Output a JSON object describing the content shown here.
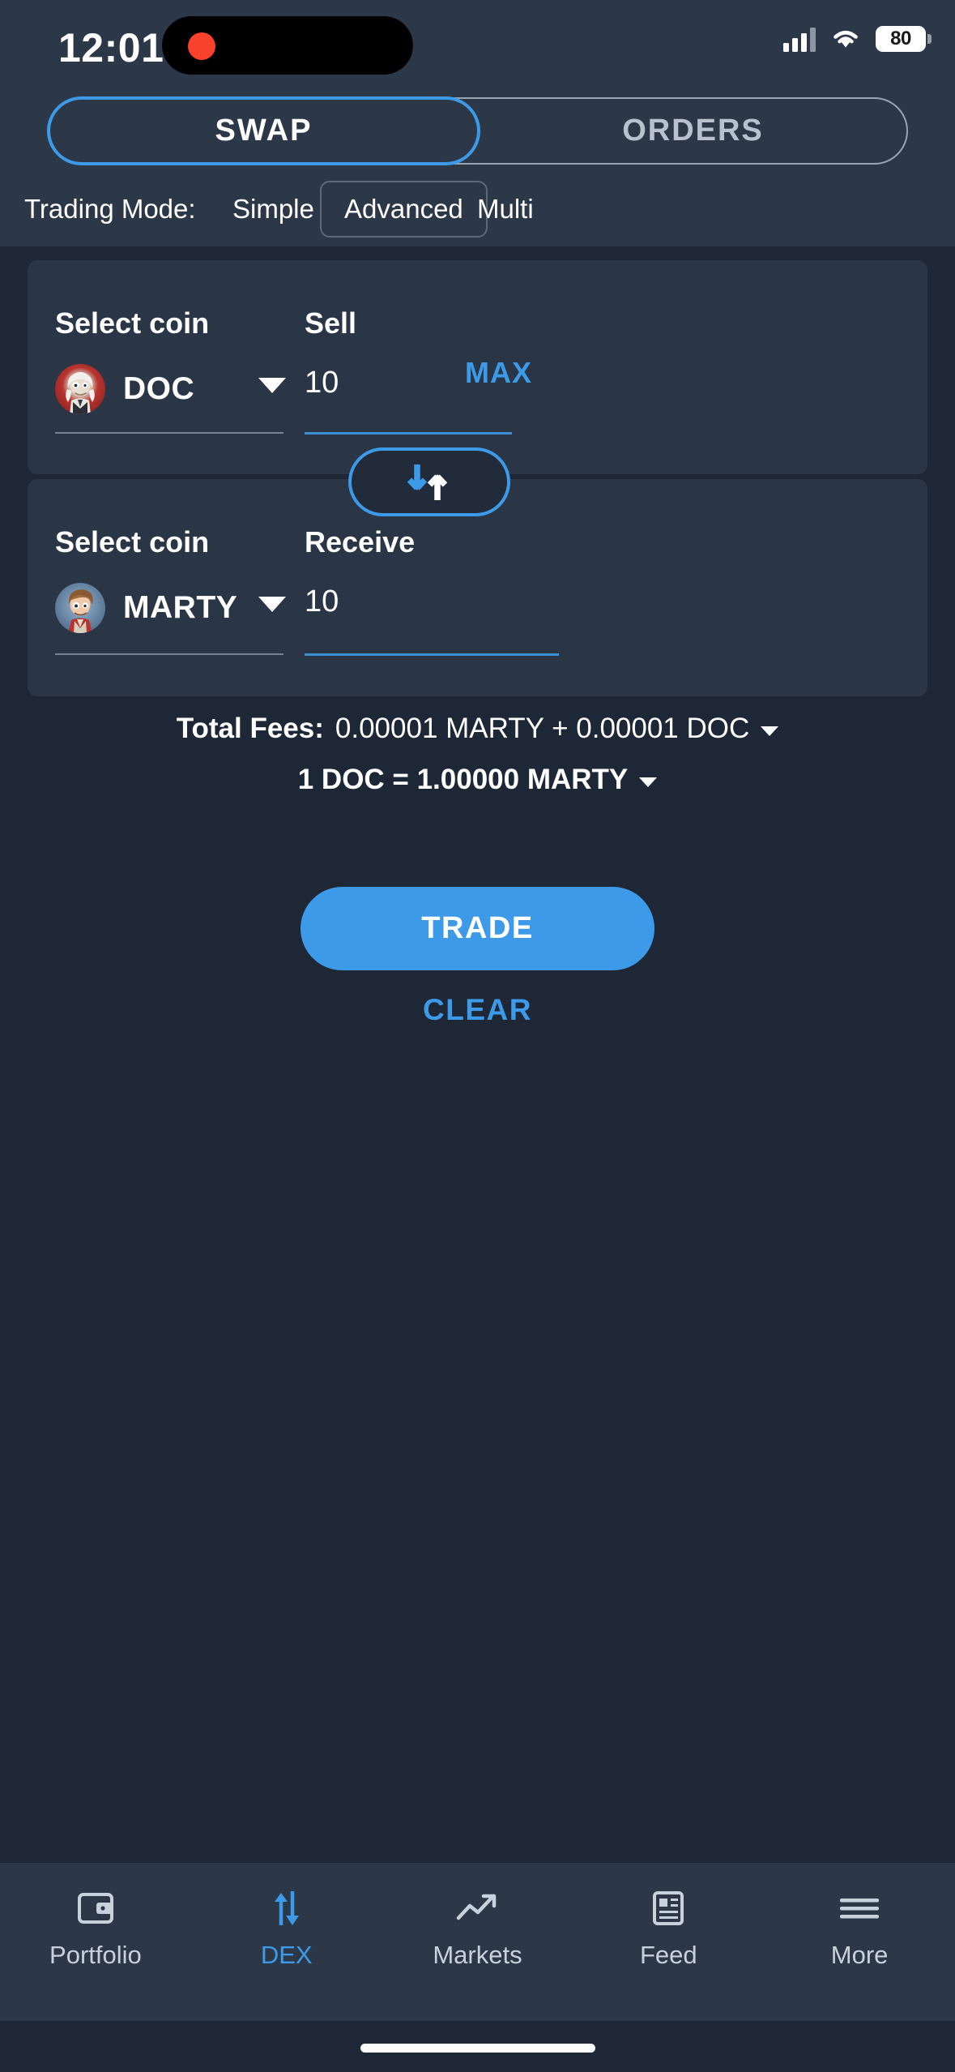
{
  "status_bar": {
    "time": "12:01",
    "battery_level": "80",
    "recording_indicator": "red-dot",
    "signal_icon": "cellular-signal-icon",
    "wifi_icon": "wifi-icon",
    "battery_icon": "battery-icon"
  },
  "top_tabs": {
    "items": [
      {
        "label": "SWAP",
        "active": true
      },
      {
        "label": "ORDERS",
        "active": false
      }
    ]
  },
  "trading_mode": {
    "label": "Trading Mode:",
    "options": [
      {
        "label": "Simple",
        "selected": false
      },
      {
        "label": "Advanced",
        "selected": true
      },
      {
        "label": "Multi",
        "selected": false
      }
    ]
  },
  "sell_card": {
    "coin_label": "Select coin",
    "amount_label": "Sell",
    "coin_symbol": "DOC",
    "coin_icon": "doc-coin-avatar",
    "amount_value": "10",
    "max_label": "MAX",
    "dropdown_icon": "chevron-down-icon"
  },
  "swap_toggle": {
    "icon": "swap-vertical-arrows-icon"
  },
  "receive_card": {
    "coin_label": "Select coin",
    "amount_label": "Receive",
    "coin_symbol": "MARTY",
    "coin_icon": "marty-coin-avatar",
    "amount_value": "10",
    "dropdown_icon": "chevron-down-icon"
  },
  "summary": {
    "fees_label": "Total Fees:",
    "fees_value": "0.00001 MARTY + 0.00001 DOC",
    "fees_expand_icon": "chevron-down-icon",
    "rate_text": "1 DOC = 1.00000 MARTY",
    "rate_expand_icon": "chevron-down-icon"
  },
  "actions": {
    "trade_label": "TRADE",
    "clear_label": "CLEAR"
  },
  "bottom_nav": {
    "items": [
      {
        "label": "Portfolio",
        "icon": "wallet-icon",
        "active": false
      },
      {
        "label": "DEX",
        "icon": "swap-arrows-icon",
        "active": true
      },
      {
        "label": "Markets",
        "icon": "chart-line-icon",
        "active": false
      },
      {
        "label": "Feed",
        "icon": "news-feed-icon",
        "active": false
      },
      {
        "label": "More",
        "icon": "hamburger-menu-icon",
        "active": false
      }
    ]
  },
  "colors": {
    "accent": "#3d9ae8",
    "background": "#1d2736",
    "surface": "#2c3848",
    "card": "#2a3545",
    "text_primary": "#ffffff",
    "text_muted": "#b8c2cf"
  }
}
